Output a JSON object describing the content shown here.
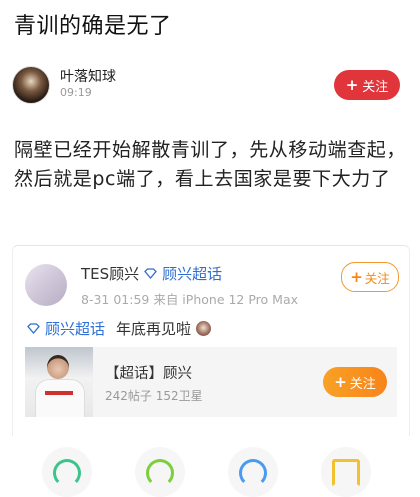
{
  "post": {
    "title": "青训的确是无了",
    "author": "叶落知球",
    "time": "09:19",
    "follow_label": "关注",
    "content": "隔壁已经开始解散青训了，先从移动端查起，然后就是pc端了，看上去国家是要下大力了"
  },
  "weibo_card": {
    "user_name": "TES顾兴",
    "topic": "顾兴超话",
    "meta": "8-31 01:59  来自 iPhone 12 Pro Max",
    "follow_label": "关注",
    "text_topic": "顾兴超话",
    "text": "年底再见啦",
    "super_topic": {
      "title": "【超话】顾兴",
      "stats": "242帖子 152卫星",
      "follow_label": "关注"
    }
  },
  "colors": {
    "red_follow": "#e0353b",
    "orange_follow": "#f7841a",
    "topic_blue": "#2e6fd3"
  },
  "icons": [
    "plus-icon",
    "diamond-icon",
    "emoji-icon"
  ]
}
